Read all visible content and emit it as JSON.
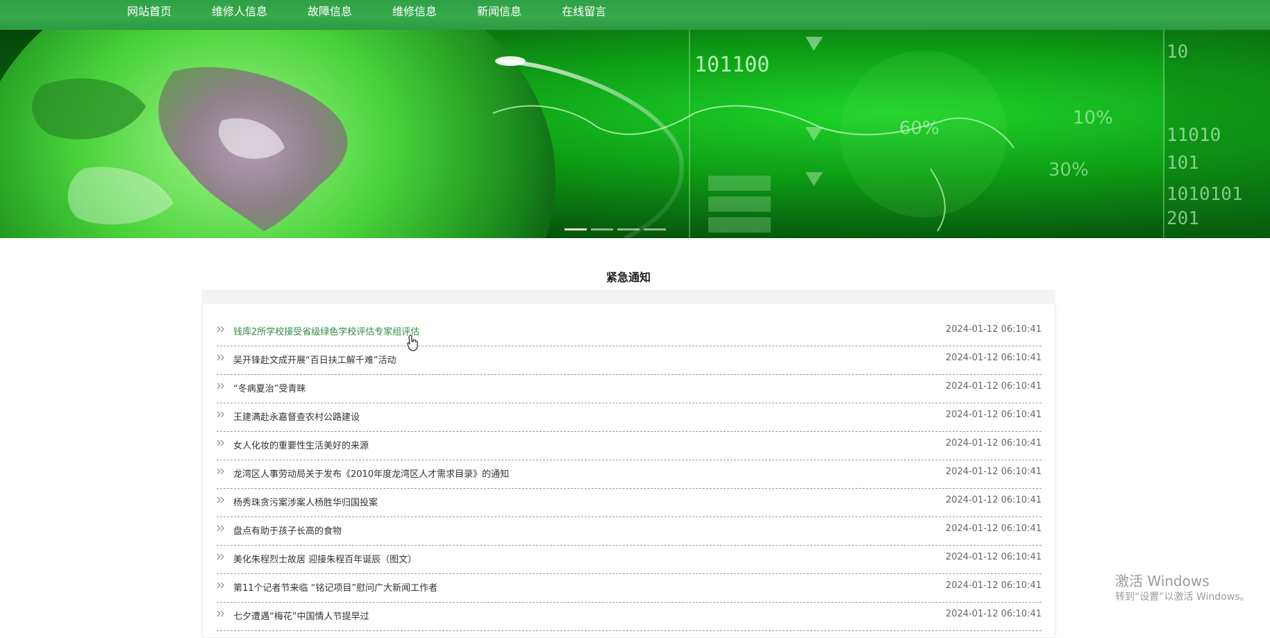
{
  "nav": {
    "items": [
      "网站首页",
      "维修人信息",
      "故障信息",
      "维修信息",
      "新闻信息",
      "在线留言"
    ]
  },
  "banner": {
    "texts": [
      "101100",
      "60%",
      "10%",
      "30%",
      "11010",
      "101",
      "1010101",
      "201",
      "10"
    ]
  },
  "notice": {
    "title": "紧急通知",
    "items": [
      {
        "title": "钱库2所学校接受省级绿色学校评估专家组评估",
        "date": "2024-01-12 06:10:41"
      },
      {
        "title": "吴开锋赴文成开展“百日扶工解千难”活动",
        "date": "2024-01-12 06:10:41"
      },
      {
        "title": "“冬病夏治”受青睐",
        "date": "2024-01-12 06:10:41"
      },
      {
        "title": "王建满赴永嘉督查农村公路建设",
        "date": "2024-01-12 06:10:41"
      },
      {
        "title": "女人化妆的重要性生活美好的来源",
        "date": "2024-01-12 06:10:41"
      },
      {
        "title": "龙湾区人事劳动局关于发布《2010年度龙湾区人才需求目录》的通知",
        "date": "2024-01-12 06:10:41"
      },
      {
        "title": "杨秀珠贪污案涉案人杨胜华归国投案",
        "date": "2024-01-12 06:10:41"
      },
      {
        "title": "盘点有助于孩子长高的食物",
        "date": "2024-01-12 06:10:41"
      },
      {
        "title": "美化朱程烈士故居 迎接朱程百年诞辰（图文）",
        "date": "2024-01-12 06:10:41"
      },
      {
        "title": "第11个记者节来临 “铭记项目”慰问广大新闻工作者",
        "date": "2024-01-12 06:10:41"
      },
      {
        "title": "七夕遭遇“梅花”中国情人节提早过",
        "date": "2024-01-12 06:10:41"
      }
    ]
  },
  "watermark": {
    "line1": "激活 Windows",
    "line2": "转到“设置”以激活 Windows。"
  },
  "colors": {
    "nav": "#37ab4c",
    "link_active": "#2e8b3a"
  }
}
